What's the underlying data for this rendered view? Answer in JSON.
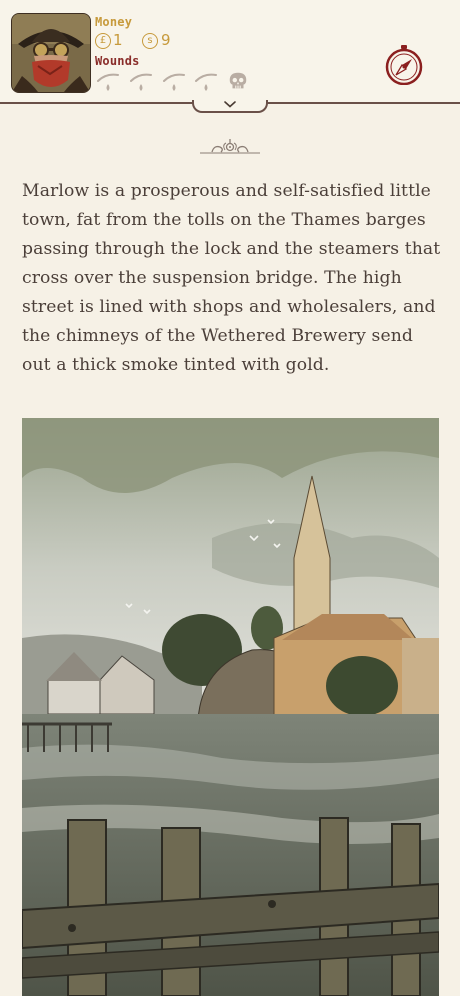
{
  "hud": {
    "money_label": "Money",
    "pounds_symbol": "£",
    "pounds_value": "1",
    "shillings_symbol": "s",
    "shillings_value": "9",
    "wounds_label": "Wounds",
    "wounds_filled": 0,
    "wounds_total": 5
  },
  "story": {
    "text": "Marlow is a prosperous and self-satisfied little town, fat from the tolls on the Thames barges passing through the lock and the steamers that cross over the suspension bridge.  The high street is lined with shops and wholesalers, and the chimneys of the Wethered Brewery send out a thick smoke tinted with gold."
  },
  "icons": {
    "portrait": "portrait-icon",
    "compass": "compass-icon",
    "wound": "teardrop-icon",
    "death": "skull-icon",
    "collapse": "chevron-down-icon",
    "ornament": "flourish-icon"
  },
  "colors": {
    "background": "#f6f1e6",
    "money": "#c79a3c",
    "wounds": "#8a2d2a",
    "text": "#4b3f39",
    "accent": "#8b1f1f"
  }
}
